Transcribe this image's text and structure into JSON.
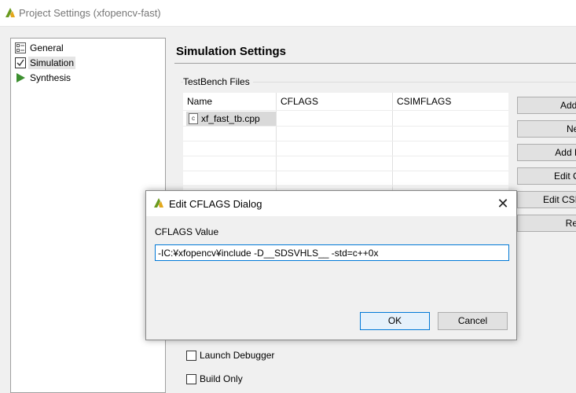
{
  "window": {
    "title": "Project Settings (xfopencv-fast)",
    "logo_icon": "vivado-hls-logo-icon"
  },
  "nav": {
    "items": [
      {
        "label": "General",
        "icon": "general-settings-icon"
      },
      {
        "label": "Simulation",
        "icon": "checkbox-checked-icon",
        "selected": true
      },
      {
        "label": "Synthesis",
        "icon": "play-arrow-icon"
      }
    ]
  },
  "page": {
    "title": "Simulation Settings"
  },
  "testbench": {
    "group_label": "TestBench Files",
    "columns": [
      "Name",
      "CFLAGS",
      "CSIMFLAGS"
    ],
    "rows": [
      {
        "name": "xf_fast_tb.cpp",
        "cflags": "",
        "csimflags": ""
      }
    ],
    "file_icon_text": "c",
    "buttons": [
      "Add F",
      "New",
      "Add Fo",
      "Edit CF",
      "Edit CSIM",
      "Rem"
    ]
  },
  "options": [
    {
      "label": "Launch Debugger",
      "checked": false
    },
    {
      "label": "Build Only",
      "checked": false
    }
  ],
  "dialog": {
    "title": "Edit CFLAGS Dialog",
    "field_label": "CFLAGS Value",
    "field_value": "-IC:¥xfopencv¥include -D__SDSVHLS__ -std=c++0x",
    "ok_label": "OK",
    "cancel_label": "Cancel",
    "close_glyph": "✕"
  },
  "colors": {
    "accent": "#0078d7",
    "logo_green": "#6a9a1f",
    "logo_yellow": "#e3a81c"
  }
}
